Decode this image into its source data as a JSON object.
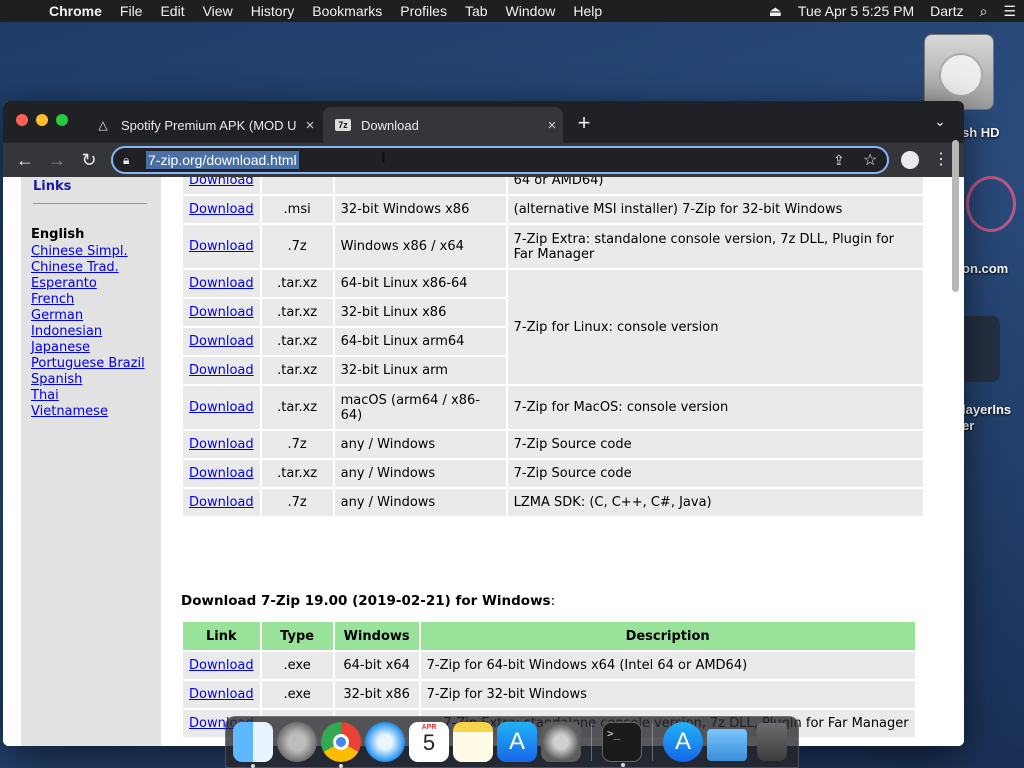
{
  "menubar": {
    "app": "Chrome",
    "items": [
      "File",
      "Edit",
      "View",
      "History",
      "Bookmarks",
      "Profiles",
      "Tab",
      "Window",
      "Help"
    ],
    "datetime": "Tue Apr 5  5:25 PM",
    "user": "Dartz"
  },
  "desktop": {
    "hd_label": "sh HD",
    "icon2_label": "on.com",
    "icon3_label": "layerIns",
    "icon3_label2": "er"
  },
  "browser": {
    "tabs": [
      {
        "label": "Spotify Premium APK (MOD U",
        "favicon": "warning-icon"
      },
      {
        "label": "Download",
        "favicon": "7z-icon"
      }
    ],
    "url": "7-zip.org/download.html"
  },
  "sidebar": {
    "links_title": "Links",
    "lang_title": "English",
    "languages": [
      "Chinese Simpl.",
      "Chinese Trad.",
      "Esperanto",
      "French",
      "German",
      "Indonesian",
      "Japanese",
      "Portuguese Brazil",
      "Spanish",
      "Thai",
      "Vietnamese"
    ]
  },
  "table1": {
    "rows": [
      {
        "link": "Download",
        "type": "",
        "os": "",
        "desc": "64 or AMD64)"
      },
      {
        "link": "Download",
        "type": ".msi",
        "os": "32-bit Windows x86",
        "desc": "(alternative MSI installer) 7-Zip for 32-bit Windows"
      },
      {
        "link": "Download",
        "type": ".7z",
        "os": "Windows x86 / x64",
        "desc": "7-Zip Extra: standalone console version, 7z DLL, Plugin for Far Manager"
      },
      {
        "link": "Download",
        "type": ".tar.xz",
        "os": "64-bit Linux x86-64",
        "desc": "7-Zip for Linux: console version"
      },
      {
        "link": "Download",
        "type": ".tar.xz",
        "os": "32-bit Linux x86",
        "desc": ""
      },
      {
        "link": "Download",
        "type": ".tar.xz",
        "os": "64-bit Linux arm64",
        "desc": ""
      },
      {
        "link": "Download",
        "type": ".tar.xz",
        "os": "32-bit Linux arm",
        "desc": ""
      },
      {
        "link": "Download",
        "type": ".tar.xz",
        "os": "macOS (arm64 / x86-64)",
        "desc": "7-Zip for MacOS: console version"
      },
      {
        "link": "Download",
        "type": ".7z",
        "os": "any / Windows",
        "desc": "7-Zip Source code"
      },
      {
        "link": "Download",
        "type": ".tar.xz",
        "os": "any / Windows",
        "desc": "7-Zip Source code"
      },
      {
        "link": "Download",
        "type": ".7z",
        "os": "any / Windows",
        "desc": "LZMA SDK: (C, C++, C#, Java)"
      }
    ]
  },
  "section2": {
    "title": "Download 7-Zip 19.00 (2019-02-21) for Windows",
    "suffix": ":",
    "headers": [
      "Link",
      "Type",
      "Windows",
      "Description"
    ],
    "rows": [
      {
        "link": "Download",
        "type": ".exe",
        "os": "64-bit x64",
        "desc": "7-Zip for 64-bit Windows x64 (Intel 64 or AMD64)"
      },
      {
        "link": "Download",
        "type": ".exe",
        "os": "32-bit x86",
        "desc": "7-Zip for 32-bit Windows"
      },
      {
        "link": "Download",
        "type": "",
        "os": "",
        "desc": "7-Zip Extra: standalone console version, 7z DLL, Plugin for Far Manager"
      }
    ]
  },
  "dock": {
    "calendar_month": "APR",
    "calendar_day": "5",
    "terminal_prompt": ">_"
  }
}
